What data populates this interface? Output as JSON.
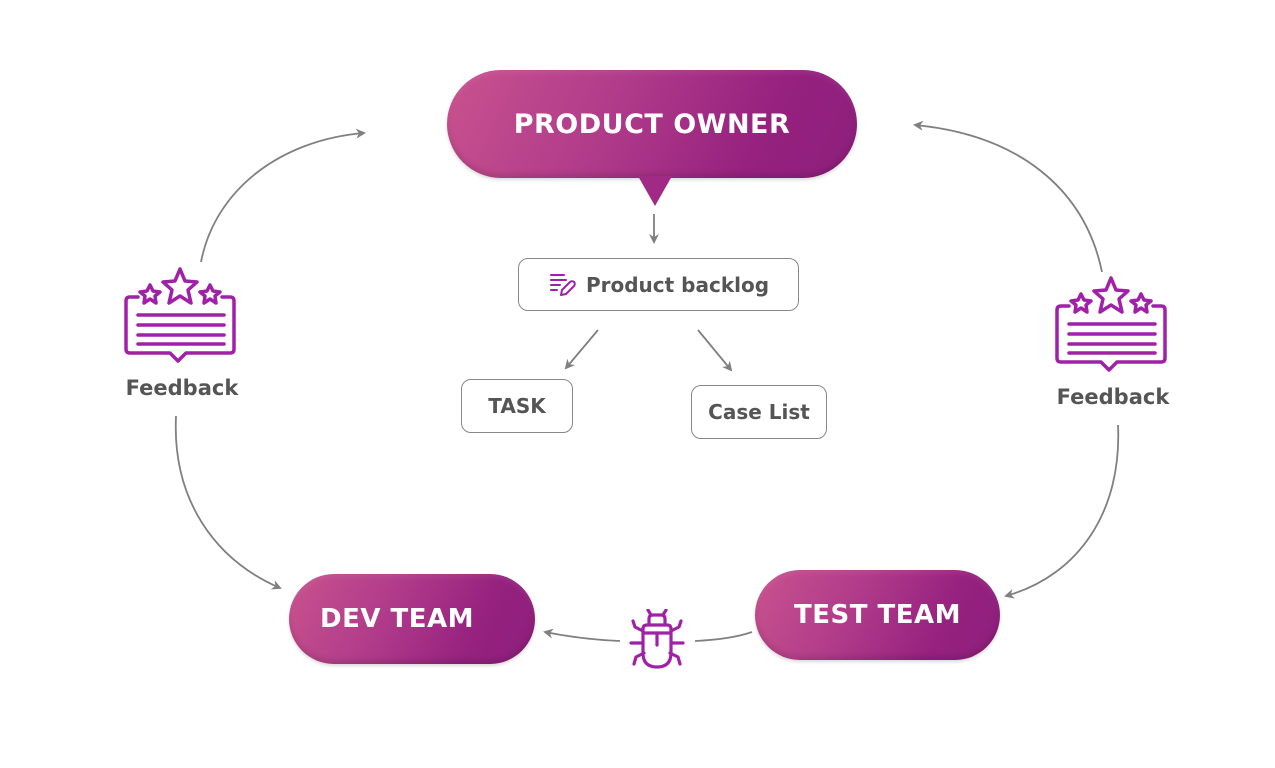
{
  "diagram": {
    "nodes": {
      "product_owner": "PRODUCT OWNER",
      "product_backlog": "Product backlog",
      "task": "TASK",
      "case_list": "Case List",
      "dev_team": "DEV TEAM",
      "test_team": "TEST TEAM"
    },
    "labels": {
      "feedback_left": "Feedback",
      "feedback_right": "Feedback"
    },
    "icons": {
      "backlog_icon": "list-edit-icon",
      "feedback_icon": "rating-feedback-icon",
      "bug_icon": "bug-icon"
    },
    "edges": [
      {
        "from": "product_owner",
        "to": "product_backlog"
      },
      {
        "from": "product_backlog",
        "to": "task"
      },
      {
        "from": "product_backlog",
        "to": "case_list"
      },
      {
        "from": "dev_team",
        "to": "product_owner",
        "via": "feedback_left"
      },
      {
        "from": "product_owner",
        "to": "dev_team",
        "via": "feedback_left"
      },
      {
        "from": "test_team",
        "to": "product_owner",
        "via": "feedback_right"
      },
      {
        "from": "product_owner",
        "to": "test_team",
        "via": "feedback_right"
      },
      {
        "from": "test_team",
        "to": "dev_team",
        "via": "bug"
      }
    ],
    "colors": {
      "accent": "#a02a84",
      "accent_light": "#c9528e",
      "icon": "#a021a8",
      "text": "#555555",
      "connector": "#808080"
    }
  }
}
